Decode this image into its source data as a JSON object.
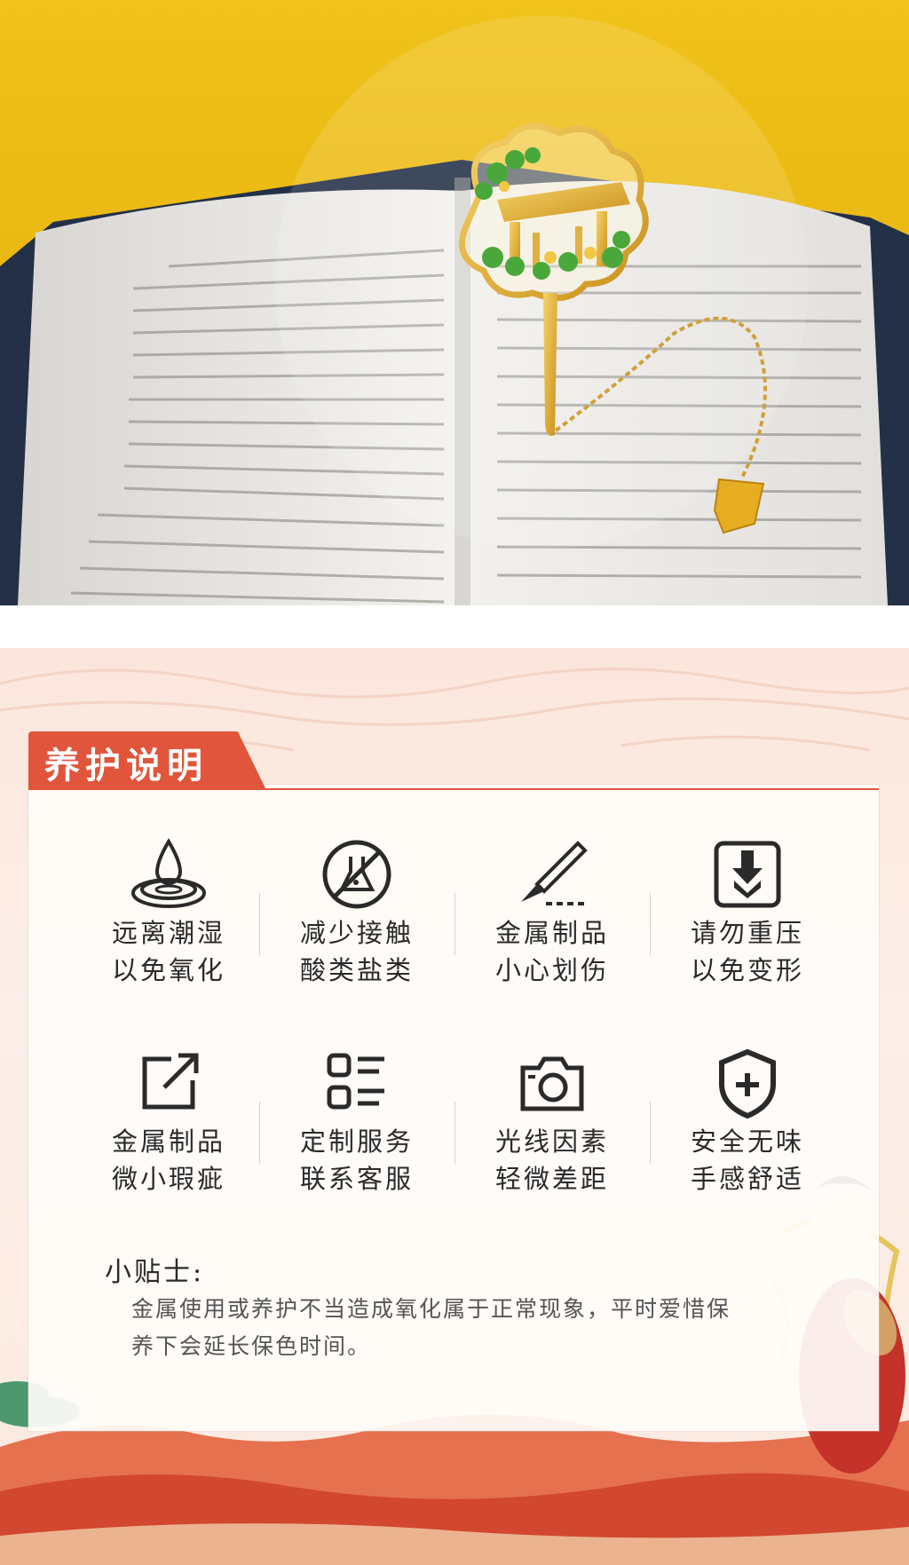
{
  "care": {
    "title": "养护说明",
    "items": [
      {
        "icon": "water-drop-icon",
        "line1": "远离潮湿",
        "line2": "以免氧化"
      },
      {
        "icon": "no-chemicals-icon",
        "line1": "减少接触",
        "line2": "酸类盐类"
      },
      {
        "icon": "scalpel-icon",
        "line1": "金属制品",
        "line2": "小心划伤"
      },
      {
        "icon": "no-press-icon",
        "line1": "请勿重压",
        "line2": "以免变形"
      },
      {
        "icon": "external-link-icon",
        "line1": "金属制品",
        "line2": "微小瑕疵"
      },
      {
        "icon": "list-icon",
        "line1": "定制服务",
        "line2": "联系客服"
      },
      {
        "icon": "camera-icon",
        "line1": "光线因素",
        "line2": "轻微差距"
      },
      {
        "icon": "shield-plus-icon",
        "line1": "安全无味",
        "line2": "手感舒适"
      }
    ],
    "tips_title": "小贴士:",
    "tips_body": "金属使用或养护不当造成氧化属于正常现象，平时爱惜保养下会延长保色时间。"
  },
  "colors": {
    "accent": "#e0553b",
    "background": "#fbe6dc",
    "photo_yellow": "#eab812",
    "bookmark_gold": "#d9a520",
    "ginkgo_green": "#4aa83a"
  }
}
